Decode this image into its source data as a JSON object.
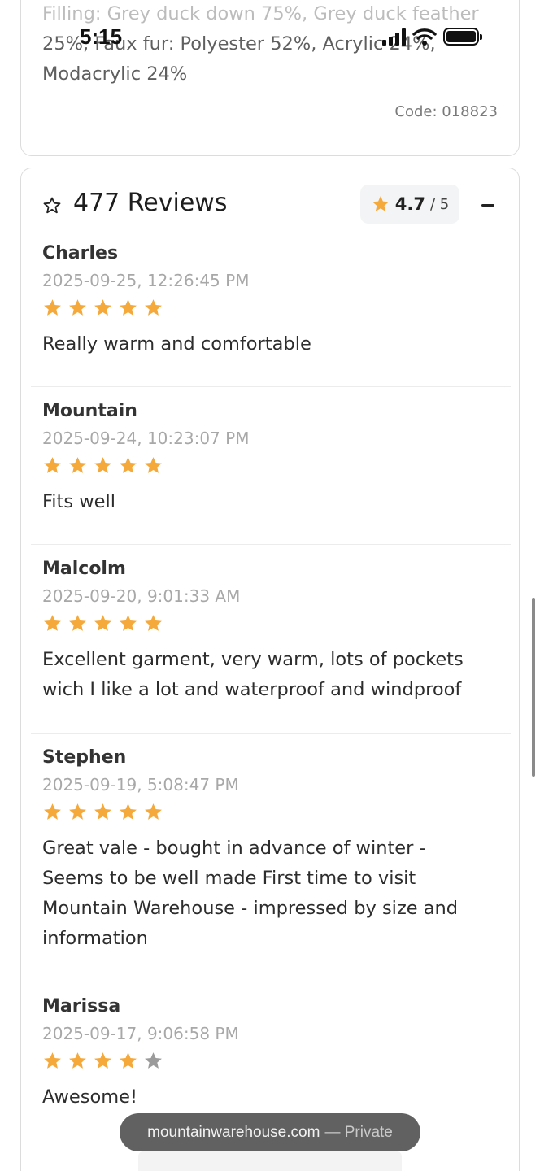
{
  "status_bar": {
    "time": "5:15"
  },
  "specs": {
    "line1": "Filling: Grey duck down 75%, Grey duck feather",
    "line2": "25%, Faux fur: Polyester 52%, Acrylic 24%,",
    "line3": "Modacrylic 24%",
    "code": "Code: 018823"
  },
  "reviews_section": {
    "title": "477 Reviews",
    "rating": "4.7",
    "rating_max": "/ 5",
    "icons": {
      "header": "star-outline-icon",
      "chip": "star-filled-icon",
      "toggle": "minus-icon"
    },
    "colors": {
      "star": "#F6A93B",
      "star_empty": "#9b9b9b"
    },
    "items": [
      {
        "name": "Charles",
        "date": "2025-09-25, 12:26:45 PM",
        "rating": 5,
        "lines": [
          "Really warm and comfortable"
        ]
      },
      {
        "name": "Mountain",
        "date": "2025-09-24, 10:23:07 PM",
        "rating": 5,
        "lines": [
          "Fits well"
        ]
      },
      {
        "name": "Malcolm",
        "date": "2025-09-20, 9:01:33 AM",
        "rating": 5,
        "lines": [
          "Excellent garment, very warm, lots of pockets",
          "wich I like a lot and waterproof and windproof"
        ]
      },
      {
        "name": "Stephen",
        "date": "2025-09-19, 5:08:47 PM",
        "rating": 5,
        "lines": [
          "Great vale - bought in advance of winter -",
          "Seems to be well made First time to visit",
          "Mountain Warehouse - impressed by size and",
          "information"
        ]
      },
      {
        "name": "Marissa",
        "date": "2025-09-17, 9:06:58 PM",
        "rating": 4,
        "lines": [
          "Awesome!"
        ]
      }
    ]
  },
  "browser": {
    "domain": "mountainwarehouse.com",
    "mode": "— Private"
  }
}
